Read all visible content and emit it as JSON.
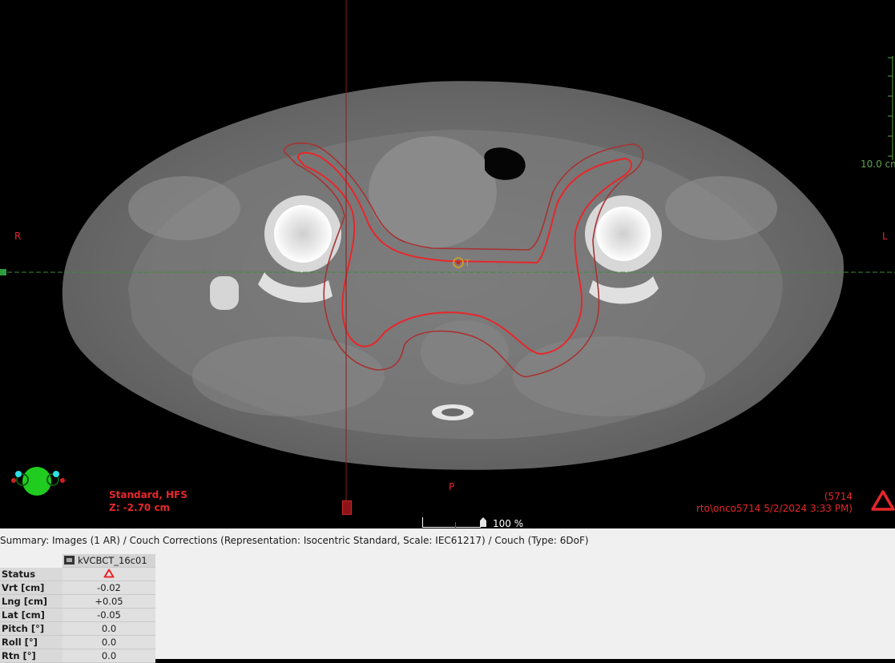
{
  "viewer": {
    "orientation": {
      "right": "R",
      "left": "L",
      "posterior": "P"
    },
    "protocol_label": "Standard, HFS",
    "z_position": "Z: -2.70 cm",
    "id_label": "(5714",
    "user_datetime": "rto\\onco5714 5/2/2024 3:33 PM)",
    "ruler_label": "10.0 cm",
    "zoom_level": "100 %",
    "warning_icon": "warning-triangle-icon",
    "colors": {
      "target_contour": "#e8262a",
      "margin_contour": "#a83232",
      "crosshair_h": "#3c8c3c",
      "crosshair_v": "#8c1c1c"
    }
  },
  "panel": {
    "summary": "Summary: Images (1 AR) / Couch Corrections (Representation: Isocentric Standard, Scale: IEC61217) / Couch (Type: 6DoF)",
    "image_column": "kVCBCT_16c01",
    "rows": [
      {
        "label": "Status",
        "value": "",
        "icon": "warning-triangle-icon"
      },
      {
        "label": "Vrt [cm]",
        "value": "-0.02"
      },
      {
        "label": "Lng [cm]",
        "value": "+0.05"
      },
      {
        "label": "Lat [cm]",
        "value": "-0.05"
      },
      {
        "label": "Pitch [°]",
        "value": "0.0"
      },
      {
        "label": "Roll [°]",
        "value": "0.0"
      },
      {
        "label": "Rtn [°]",
        "value": "0.0"
      }
    ]
  }
}
